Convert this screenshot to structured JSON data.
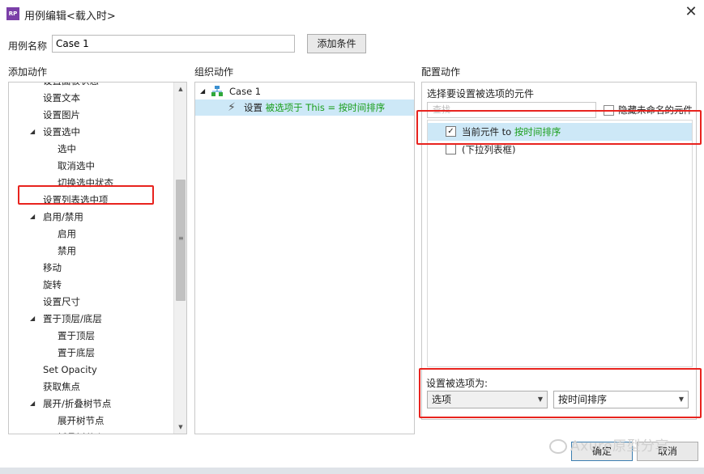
{
  "window": {
    "title": "用例编辑<载入时>",
    "app_icon": "RP",
    "close_glyph": "✕"
  },
  "case_name": {
    "label": "用例名称",
    "value": "Case 1",
    "add_condition_label": "添加条件"
  },
  "sections": {
    "add_action": "添加动作",
    "organize_action": "组织动作",
    "configure_action": "配置动作"
  },
  "action_tree": [
    {
      "label": "设置面板状态",
      "indent": 0,
      "arrow": ""
    },
    {
      "label": "设置文本",
      "indent": 0,
      "arrow": ""
    },
    {
      "label": "设置图片",
      "indent": 0,
      "arrow": ""
    },
    {
      "label": "设置选中",
      "indent": 0,
      "arrow": "◢"
    },
    {
      "label": "选中",
      "indent": 1,
      "arrow": ""
    },
    {
      "label": "取消选中",
      "indent": 1,
      "arrow": ""
    },
    {
      "label": "切换选中状态",
      "indent": 1,
      "arrow": ""
    },
    {
      "label": "设置列表选中项",
      "indent": 0,
      "arrow": ""
    },
    {
      "label": "启用/禁用",
      "indent": 0,
      "arrow": "◢"
    },
    {
      "label": "启用",
      "indent": 1,
      "arrow": ""
    },
    {
      "label": "禁用",
      "indent": 1,
      "arrow": ""
    },
    {
      "label": "移动",
      "indent": 0,
      "arrow": ""
    },
    {
      "label": "旋转",
      "indent": 0,
      "arrow": ""
    },
    {
      "label": "设置尺寸",
      "indent": 0,
      "arrow": ""
    },
    {
      "label": "置于顶层/底层",
      "indent": 0,
      "arrow": "◢"
    },
    {
      "label": "置于顶层",
      "indent": 1,
      "arrow": ""
    },
    {
      "label": "置于底层",
      "indent": 1,
      "arrow": ""
    },
    {
      "label": "Set Opacity",
      "indent": 0,
      "arrow": ""
    },
    {
      "label": "获取焦点",
      "indent": 0,
      "arrow": ""
    },
    {
      "label": "展开/折叠树节点",
      "indent": 0,
      "arrow": "◢"
    },
    {
      "label": "展开树节点",
      "indent": 1,
      "arrow": ""
    },
    {
      "label": "折叠树节点",
      "indent": 1,
      "arrow": ""
    }
  ],
  "scrollbar": {
    "up": "▲",
    "down": "▼",
    "grip": "≡"
  },
  "organize": {
    "case_arrow": "◢",
    "case_label": "Case 1",
    "action_prefix": "设置",
    "action_detail": "被选项于 This = 按时间排序",
    "bolt": "⚡"
  },
  "configure": {
    "title": "选择要设置被选项的元件",
    "search_placeholder": "查找",
    "hide_unnamed_label": "隐藏未命名的元件",
    "widgets": [
      {
        "checked": true,
        "check_glyph": "✓",
        "prefix": "当前元件 to",
        "value": "按时间排序"
      },
      {
        "checked": false,
        "check_glyph": "",
        "prefix": "(下拉列表框)",
        "value": ""
      }
    ],
    "set_as_label": "设置被选项为:",
    "select_type": {
      "value": "选项",
      "caret": "▼"
    },
    "select_value": {
      "value": "按时间排序",
      "caret": "▼"
    }
  },
  "footer": {
    "ok_label": "确定",
    "cancel_label": "取消"
  },
  "watermark": "Axure原型分享",
  "accent_colors": {
    "highlight": "#e8231e",
    "selection": "#cde8f7",
    "green_text": "#1a9e1a"
  }
}
